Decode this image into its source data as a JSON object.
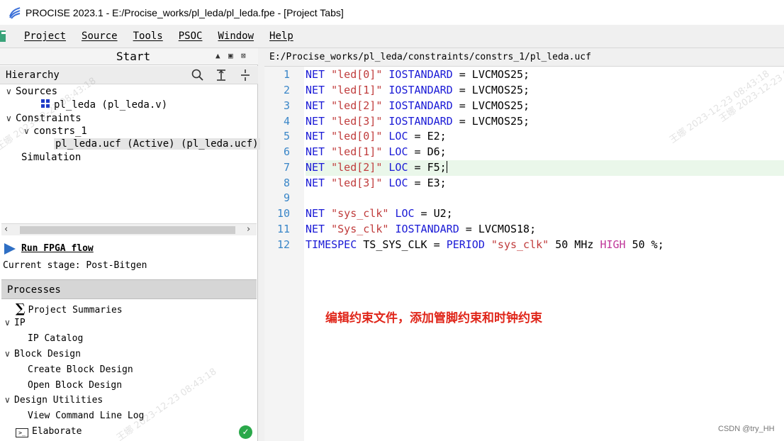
{
  "window": {
    "title": "PROCISE 2023.1  - E:/Procise_works/pl_leda/pl_leda.fpe - [Project Tabs]",
    "icon": "procise-logo-icon"
  },
  "menu": {
    "items": [
      "Project",
      "Source",
      "Tools",
      "PSOC",
      "Window",
      "Help"
    ]
  },
  "start_panel": {
    "title": "Start",
    "controls": [
      "▲",
      "▣",
      "⊠"
    ]
  },
  "hierarchy": {
    "label": "Hierarchy",
    "icons": [
      "search-icon",
      "expand-icon",
      "collapse-icon"
    ],
    "tree": {
      "sources": "Sources",
      "source_file": "pl_leda (pl_leda.v)",
      "constraints": "Constraints",
      "constraint_set": "constrs_1",
      "constraint_file": "pl_leda.ucf (Active) (pl_leda.ucf)",
      "simulation": "Simulation"
    }
  },
  "flow": {
    "run_label": "Run FPGA flow",
    "stage": "Current stage: Post-Bitgen"
  },
  "processes": {
    "label": "Processes",
    "items": {
      "summaries": "Project Summaries",
      "ip": "IP",
      "ip_catalog": "IP Catalog",
      "block_design": "Block Design",
      "create_block": "Create Block Design",
      "open_block": "Open Block Design",
      "utilities": "Design Utilities",
      "cmd_log": "View Command Line Log",
      "elaborate": "Elaborate"
    }
  },
  "editor": {
    "path": "E:/Procise_works/pl_leda/constraints/constrs_1/pl_leda.ucf",
    "line_numbers": [
      "1",
      "2",
      "3",
      "4",
      "5",
      "6",
      "7",
      "8",
      "9",
      "10",
      "11",
      "12"
    ],
    "lines": {
      "l1": {
        "a": "NET ",
        "b": "\"led[0]\"",
        "c": " ",
        "d": "IOSTANDARD",
        "e": " = LVCMOS25;"
      },
      "l2": {
        "a": "NET ",
        "b": "\"led[1]\"",
        "c": " ",
        "d": "IOSTANDARD",
        "e": " = LVCMOS25;"
      },
      "l3": {
        "a": "NET ",
        "b": "\"led[2]\"",
        "c": " ",
        "d": "IOSTANDARD",
        "e": " = LVCMOS25;"
      },
      "l4": {
        "a": "NET ",
        "b": "\"led[3]\"",
        "c": " ",
        "d": "IOSTANDARD",
        "e": " = LVCMOS25;"
      },
      "l5": {
        "a": "NET ",
        "b": "\"led[0]\"",
        "c": " ",
        "d": "LOC",
        "e": " = E2;"
      },
      "l6": {
        "a": "NET ",
        "b": "\"led[1]\"",
        "c": " ",
        "d": "LOC",
        "e": " = D6;"
      },
      "l7": {
        "a": "NET ",
        "b": "\"led[2]\"",
        "c": " ",
        "d": "LOC",
        "e": " = F5;"
      },
      "l8": {
        "a": "NET ",
        "b": "\"led[3]\"",
        "c": " ",
        "d": "LOC",
        "e": " = E3;"
      },
      "l10": {
        "a": "NET ",
        "b": "\"sys_clk\"",
        "c": " ",
        "d": "LOC",
        "e": " = U2;"
      },
      "l11": {
        "a": "NET ",
        "b": "\"Sys_clk\"",
        "c": " ",
        "d": "IOSTANDARD",
        "e": " = LVCMOS18;"
      },
      "l12": {
        "a": "TIMESPEC",
        "b": " TS_SYS_CLK = ",
        "c": "PERIOD",
        "d": " \"sys_clk\"",
        "e": " 50 MHz ",
        "f": "HIGH",
        "g": " 50 %;"
      }
    },
    "highlight_line": 7
  },
  "annotation": "编辑约束文件，添加管脚约束和时钟约束",
  "watermarks": [
    "王娜 2023-12-23 08:43:18"
  ],
  "credit": "CSDN @try_HH",
  "colors": {
    "keyword": "#1a1ad6",
    "string": "#c03c3c",
    "pink_keyword": "#c0389a",
    "line_number": "#3a86c8",
    "annotation": "#e0261a",
    "status_ok": "#2aa84a"
  }
}
